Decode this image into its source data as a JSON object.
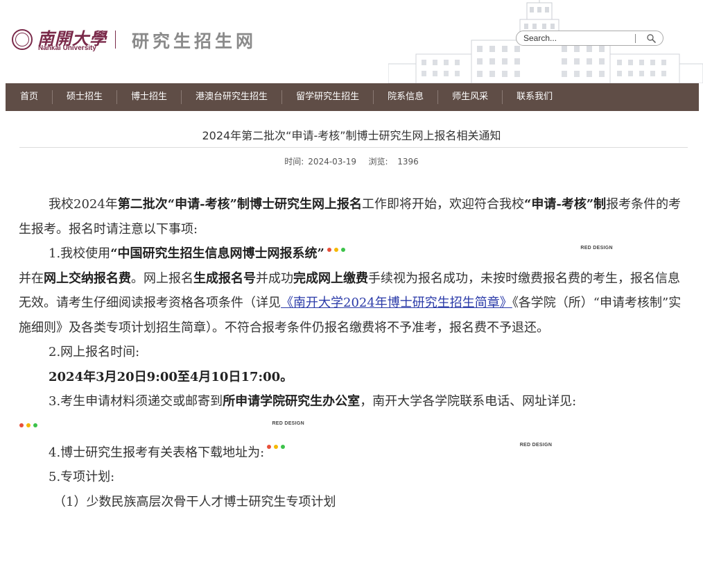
{
  "header": {
    "logo_cn": "南開大學",
    "logo_en": "Nankai University",
    "site_title": "研究生招生网",
    "search_placeholder": "Search..."
  },
  "nav": {
    "items": [
      "首页",
      "硕士招生",
      "博士招生",
      "港澳台研究生招生",
      "留学研究生招生",
      "院系信息",
      "师生风采",
      "联系我们"
    ]
  },
  "article": {
    "title": "2024年第二批次“申请-考核”制博士研究生网上报名相关通知",
    "time_label": "时间:",
    "time_value": "2024-03-19",
    "views_label": "浏览:",
    "views_value": "1396"
  },
  "banner": {
    "text": "RED DESIGN",
    "dot_colors": [
      "#e8503a",
      "#f5b800",
      "#3cc24a"
    ],
    "stripe_colors": [
      "#c07be0",
      "#7fb2ea",
      "#e6eaee",
      "#f4e4a2",
      "#f2b47a"
    ]
  },
  "body": {
    "p1": {
      "a": "我校2024年",
      "b": "第二批次“申请-考核”制博士研究生网上报名",
      "c": "工作即将开始，欢迎符合我校",
      "d": "“申请-考核”制",
      "e": "报考条件的考生报考。报名时请注意以下事项:"
    },
    "p2": {
      "a": "1.我校使用",
      "b": "“中国研究生招生信息网博士网报系统”",
      "c": "并在",
      "d": "网上交纳报名费",
      "e": "。网上报名",
      "f": "生成报名号",
      "g": "并成功",
      "h": "完成网上缴费",
      "i": "手续视为报名成功，未按时缴费报名费的考生，报名信息无效。请考生仔细阅读报考资格各项条件（详见",
      "link": "《南开大学2024年博士研究生招生简章》",
      "j": "《各学院（所）“申请考核制”实施细则》及各类专项计划招生简章）。不符合报考条件仍报名缴费将不予准考，报名费不予退还。"
    },
    "p3": "2.网上报名时间:",
    "p4": "2024年3月20日9:00至4月10日17:00。",
    "p5": {
      "a": "3.考生申请材料须递交或邮寄到",
      "b": "所申请学院研究生办公室",
      "c": "，南开大学各学院联系电话、网址详见:"
    },
    "p6": "4.博士研究生报考有关表格下载地址为:",
    "p7": "5.专项计划:",
    "p8": "（1）少数民族高层次骨干人才博士研究生专项计划"
  }
}
